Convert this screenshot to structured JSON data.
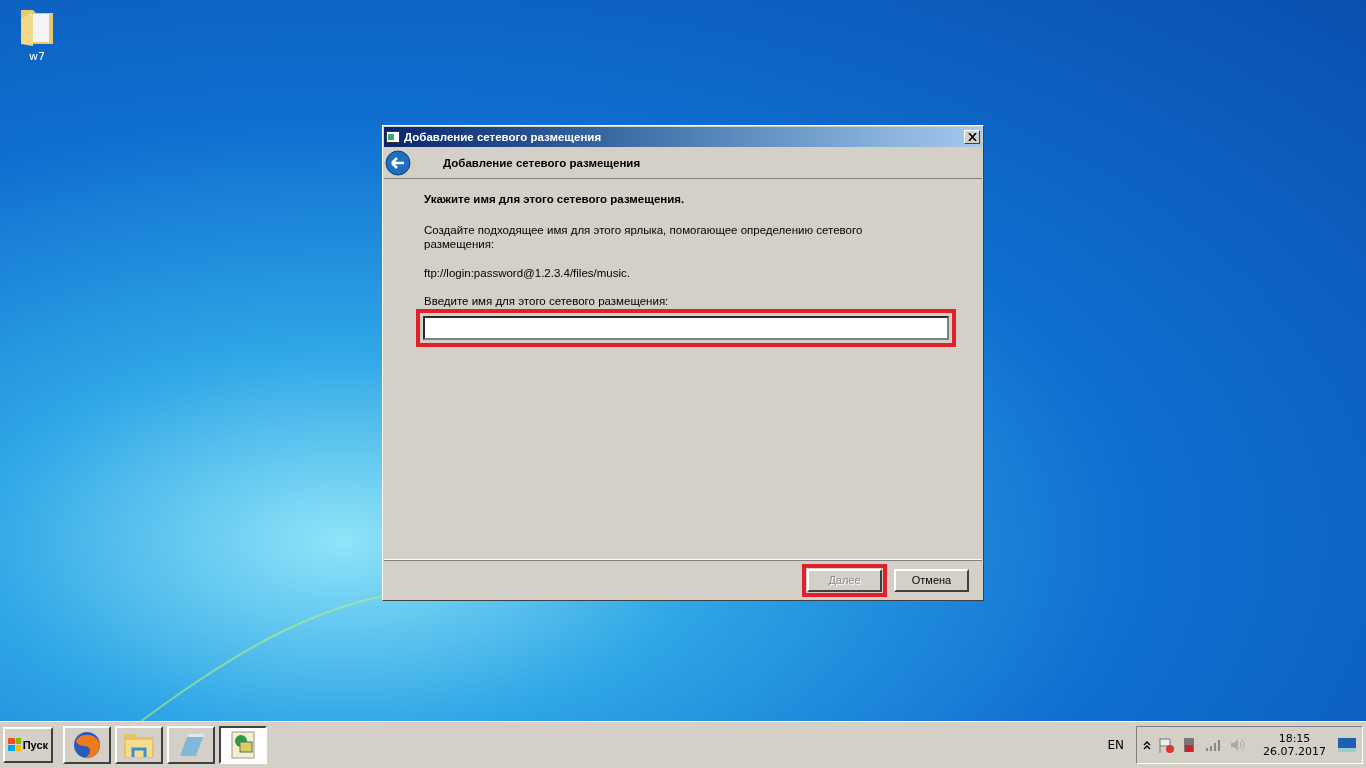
{
  "desktop_icons": [
    {
      "label": "w7"
    }
  ],
  "dialog": {
    "title": "Добавление сетевого размещения",
    "header": "Добавление сетевого размещения",
    "heading": "Укажите имя для этого сетевого размещения.",
    "description": "Создайте подходящее имя для этого ярлыка, помогающее определению сетевого размещения:",
    "address": "ftp://login:password@1.2.3.4/files/music.",
    "field_label": "Введите имя для этого сетевого размещения:",
    "name_field": {
      "highlighted": true
    },
    "buttons": [
      {
        "label": "Далее",
        "disabled": true,
        "highlighted": true
      },
      {
        "label": "Отмена",
        "disabled": false,
        "highlighted": false
      }
    ]
  },
  "taskbar": {
    "start_label": "Пуск",
    "apps": [
      {
        "kind": "browser",
        "selected": false
      },
      {
        "kind": "folder",
        "selected": false
      },
      {
        "kind": "notepad",
        "selected": false
      },
      {
        "kind": "network",
        "selected": true
      }
    ],
    "language": "EN",
    "time": "18:15",
    "date": "26.07.2017"
  }
}
